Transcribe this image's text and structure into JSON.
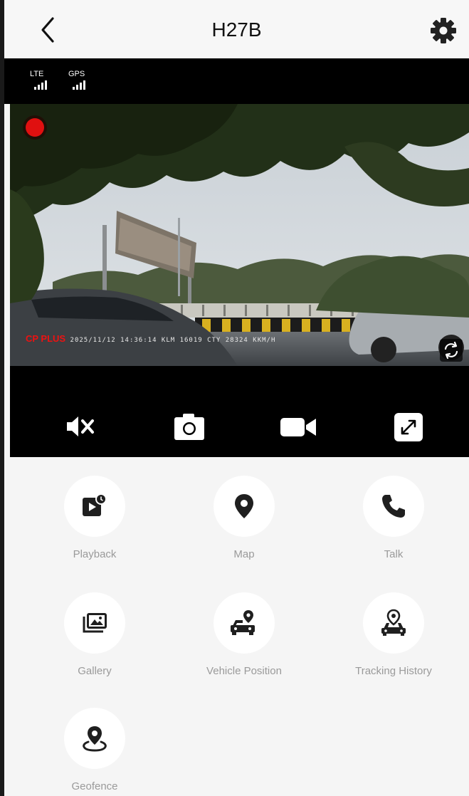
{
  "header": {
    "title": "H27B"
  },
  "signals": [
    {
      "label": "LTE"
    },
    {
      "label": "GPS"
    }
  ],
  "video": {
    "brand": "CP PLUS",
    "overlay": "2025/11/12 14:36:14  KLM 16019 CTY 28324  KKM/H"
  },
  "menu": [
    {
      "label": "Playback",
      "icon": "playback-icon"
    },
    {
      "label": "Map",
      "icon": "map-pin-icon"
    },
    {
      "label": "Talk",
      "icon": "phone-icon"
    },
    {
      "label": "Gallery",
      "icon": "gallery-icon"
    },
    {
      "label": "Vehicle Position",
      "icon": "vehicle-position-icon"
    },
    {
      "label": "Tracking History",
      "icon": "tracking-history-icon"
    },
    {
      "label": "Geofence",
      "icon": "geofence-icon"
    }
  ]
}
